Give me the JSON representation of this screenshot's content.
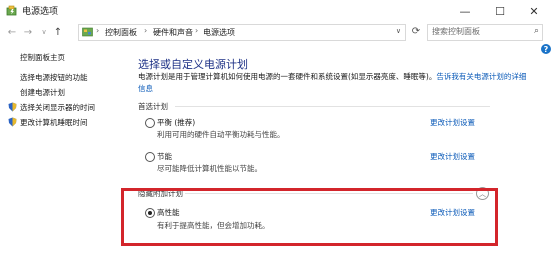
{
  "window": {
    "title": "电源选项",
    "minimize_glyph": "—",
    "maximize_glyph": "☐",
    "close_glyph": "✕"
  },
  "address_bar": {
    "back_glyph": "←",
    "forward_glyph": "→",
    "recent_glyph": "∨",
    "up_glyph": "↑",
    "breadcrumb": [
      "控制面板",
      "硬件和声音",
      "电源选项"
    ],
    "separator": "›",
    "dropdown_glyph": "∨",
    "refresh_glyph": "⟳"
  },
  "search": {
    "placeholder": "搜索控制面板",
    "icon_glyph": "⌕"
  },
  "help_glyph": "?",
  "sidebar": {
    "items": [
      {
        "label": "控制面板主页"
      },
      {
        "label": "选择电源按钮的功能"
      },
      {
        "label": "创建电源计划"
      },
      {
        "label": "选择关闭显示器的时间",
        "icon": "shield-icon"
      },
      {
        "label": "更改计算机睡眠时间",
        "icon": "shield-icon"
      }
    ]
  },
  "main": {
    "heading": "选择或自定义电源计划",
    "description": "电源计划是用于管理计算机如何使用电源的一套硬件和系统设置(如显示器亮度、睡眠等)。",
    "description_link": "告诉我有关电源计划的详细信息",
    "preferred_label": "首选计划",
    "additional_label": "隐藏附加计划",
    "collapse_glyph": "︿",
    "plans": [
      {
        "name": "平衡 (推荐)",
        "desc": "利用可用的硬件自动平衡功耗与性能。",
        "link": "更改计划设置",
        "selected": false
      },
      {
        "name": "节能",
        "desc": "尽可能降低计算机性能以节能。",
        "link": "更改计划设置",
        "selected": false
      },
      {
        "name": "高性能",
        "desc": "有利于提高性能，但会增加功耗。",
        "link": "更改计划设置",
        "selected": true
      }
    ]
  },
  "colors": {
    "heading": "#1e3287",
    "link": "#0a5ab8",
    "highlight": "#d3252b"
  }
}
